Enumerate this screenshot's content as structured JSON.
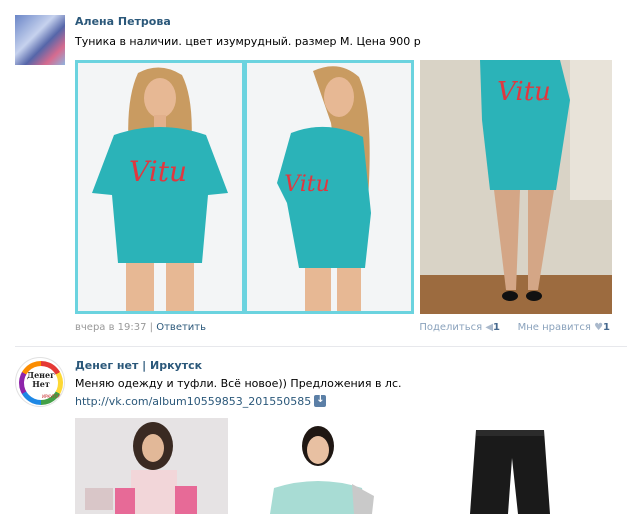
{
  "post1": {
    "author": "Алена Петрова",
    "text": "Туника в наличии. цвет изумрудный. размер М. Цена 900 р",
    "photos": [
      {
        "print": "Vitu"
      },
      {
        "print": "Vitu"
      },
      {
        "print": "Vitu"
      }
    ],
    "time": "вчера в 19:37",
    "separator": " | ",
    "reply": "Ответить",
    "share_label": "Поделиться",
    "share_count": "1",
    "like_label": "Мне нравится",
    "like_count": "1"
  },
  "post2": {
    "author": "Денег нет | Иркутск",
    "logo_text": "Денег Нет",
    "logo_sub": "ИРКУТСК",
    "text": "Меняю одежду и туфли. Всё новое)) Предложения в лс.",
    "link": "http://vk.com/album10559853_201550585"
  },
  "colors": {
    "link": "#2b587a",
    "frame": "#6bd3df",
    "dress": "#2bb3b8"
  }
}
